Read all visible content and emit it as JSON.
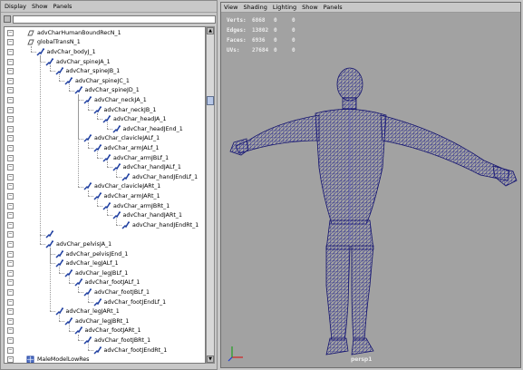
{
  "outliner": {
    "menu": [
      "Display",
      "Show",
      "Panels"
    ],
    "filter_value": "",
    "items": [
      {
        "label": "advCharHumanBoundRecN_1",
        "depth": 0,
        "icon": "bounding-box-icon"
      },
      {
        "label": "globalTransN_1",
        "depth": 0,
        "icon": "transform-node-icon"
      },
      {
        "label": "advChar_bodyJ_1",
        "depth": 1,
        "icon": "joint-icon"
      },
      {
        "label": "advChar_spineJA_1",
        "depth": 2,
        "icon": "joint-icon"
      },
      {
        "label": "advChar_spineJB_1",
        "depth": 3,
        "icon": "joint-icon"
      },
      {
        "label": "advChar_spineJC_1",
        "depth": 4,
        "icon": "joint-icon"
      },
      {
        "label": "advChar_spineJD_1",
        "depth": 5,
        "icon": "joint-icon"
      },
      {
        "label": "advChar_neckJA_1",
        "depth": 6,
        "icon": "joint-icon"
      },
      {
        "label": "advChar_neckJB_1",
        "depth": 7,
        "icon": "joint-icon"
      },
      {
        "label": "advChar_headJA_1",
        "depth": 8,
        "icon": "joint-icon"
      },
      {
        "label": "advChar_headJEnd_1",
        "depth": 9,
        "icon": "joint-icon"
      },
      {
        "label": "advChar_clavicleJALf_1",
        "depth": 6,
        "icon": "joint-icon"
      },
      {
        "label": "advChar_armJALf_1",
        "depth": 7,
        "icon": "joint-icon"
      },
      {
        "label": "advChar_armJBLf_1",
        "depth": 8,
        "icon": "joint-icon"
      },
      {
        "label": "advChar_handJALf_1",
        "depth": 9,
        "icon": "joint-icon"
      },
      {
        "label": "advChar_handJEndLf_1",
        "depth": 10,
        "icon": "joint-icon"
      },
      {
        "label": "advChar_clavicleJARt_1",
        "depth": 6,
        "icon": "joint-icon"
      },
      {
        "label": "advChar_armJARt_1",
        "depth": 7,
        "icon": "joint-icon"
      },
      {
        "label": "advChar_armJBRt_1",
        "depth": 8,
        "icon": "joint-icon"
      },
      {
        "label": "advChar_handJARt_1",
        "depth": 9,
        "icon": "joint-icon"
      },
      {
        "label": "advChar_handJEndRt_1",
        "depth": 10,
        "icon": "joint-icon"
      },
      {
        "label": "",
        "depth": 2,
        "icon": "joint-icon"
      },
      {
        "label": "advChar_pelvisJA_1",
        "depth": 2,
        "icon": "joint-icon"
      },
      {
        "label": "advChar_pelvisJEnd_1",
        "depth": 3,
        "icon": "joint-icon"
      },
      {
        "label": "advChar_legJALf_1",
        "depth": 3,
        "icon": "joint-icon"
      },
      {
        "label": "advChar_legJBLf_1",
        "depth": 4,
        "icon": "joint-icon"
      },
      {
        "label": "advChar_footJALf_1",
        "depth": 5,
        "icon": "joint-icon"
      },
      {
        "label": "advChar_footJBLf_1",
        "depth": 6,
        "icon": "joint-icon"
      },
      {
        "label": "advChar_footJEndLf_1",
        "depth": 7,
        "icon": "joint-icon"
      },
      {
        "label": "advChar_legJARt_1",
        "depth": 3,
        "icon": "joint-icon"
      },
      {
        "label": "advChar_legJBRt_1",
        "depth": 4,
        "icon": "joint-icon"
      },
      {
        "label": "advChar_footJARt_1",
        "depth": 5,
        "icon": "joint-icon"
      },
      {
        "label": "advChar_footJBRt_1",
        "depth": 6,
        "icon": "joint-icon"
      },
      {
        "label": "advChar_footJEndRt_1",
        "depth": 7,
        "icon": "joint-icon"
      },
      {
        "label": "MaleModelLowRes",
        "depth": 0,
        "icon": "mesh-icon"
      }
    ]
  },
  "viewport": {
    "menu": [
      "View",
      "Shading",
      "Lighting",
      "Show",
      "Panels"
    ],
    "hud": [
      {
        "label": "Verts:",
        "v1": "6868",
        "v2": "0",
        "v3": "0"
      },
      {
        "label": "Edges:",
        "v1": "13802",
        "v2": "0",
        "v3": "0"
      },
      {
        "label": "Faces:",
        "v1": "6936",
        "v2": "0",
        "v3": "0"
      },
      {
        "label": "UVs:",
        "v1": "27684",
        "v2": "0",
        "v3": "0"
      }
    ],
    "camera": "persp1",
    "wire_color": "#1a1a8c",
    "background_color": "#a2a2a2"
  }
}
